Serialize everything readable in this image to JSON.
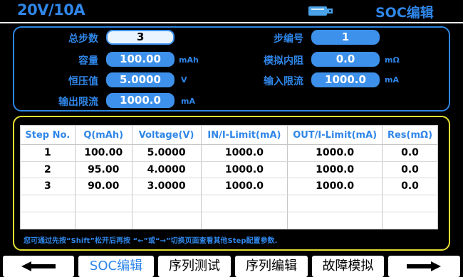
{
  "header": {
    "range": "20V/10A",
    "mode_title": "SOC编辑",
    "usb_icon": "usb-icon"
  },
  "params": {
    "total_steps": {
      "label": "总步数",
      "value": "3"
    },
    "step_no": {
      "label": "步编号",
      "value": "1"
    },
    "capacity": {
      "label": "容量",
      "value": "100.00",
      "unit": "mAh"
    },
    "sim_resistance": {
      "label": "模拟内阻",
      "value": "0.0",
      "unit": "mΩ"
    },
    "cv_value": {
      "label": "恒压值",
      "value": "5.0000",
      "unit": "V"
    },
    "input_limit": {
      "label": "输入限流",
      "value": "1000.0",
      "unit": "mA"
    },
    "output_limit": {
      "label": "输出限流",
      "value": "1000.0",
      "unit": "mA"
    }
  },
  "table": {
    "headers": [
      "Step No.",
      "Q(mAh)",
      "Voltage(V)",
      "IN/I-Limit(mA)",
      "OUT/I-Limit(mA)",
      "Res(mΩ)"
    ],
    "rows": [
      [
        "1",
        "100.00",
        "5.0000",
        "1000.0",
        "1000.0",
        "0.0"
      ],
      [
        "2",
        "95.00",
        "4.0000",
        "1000.0",
        "1000.0",
        "0.0"
      ],
      [
        "3",
        "90.00",
        "3.0000",
        "1000.0",
        "1000.0",
        "0.0"
      ]
    ],
    "note": "您可通过先按“Shift”松开后再按 “←”或“→”切换页面查看其他Step配置参数."
  },
  "bottom": {
    "left_arrow": "arrow-left-icon",
    "soc_edit": "SOC编辑",
    "sequence_test": "序列测试",
    "sequence_edit": "序列编辑",
    "fault_sim": "故障模拟",
    "right_arrow": "arrow-right-icon"
  },
  "colors": {
    "accent": "#2f86e8",
    "table_border": "#e7e034",
    "background": "#000000"
  }
}
